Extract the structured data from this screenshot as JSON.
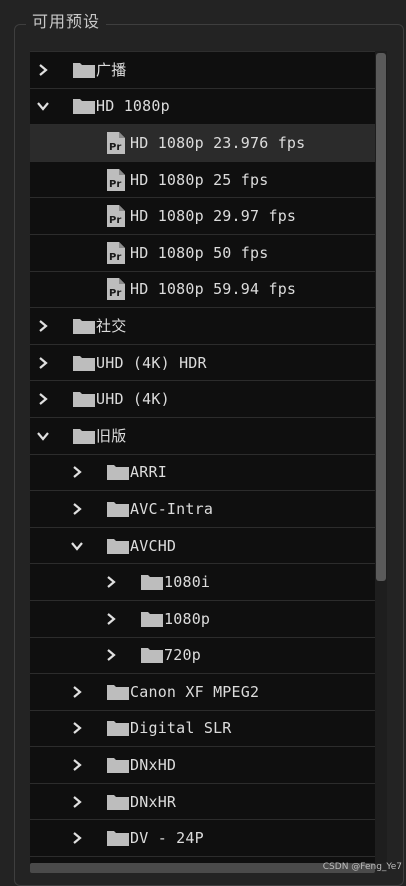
{
  "panel": {
    "title": "可用预设"
  },
  "tree": [
    {
      "depth": 0,
      "kind": "folder",
      "state": "collapsed",
      "label": "广播"
    },
    {
      "depth": 0,
      "kind": "folder",
      "state": "expanded",
      "label": "HD 1080p"
    },
    {
      "depth": 1,
      "kind": "preset",
      "label": "HD 1080p 23.976 fps",
      "selected": true
    },
    {
      "depth": 1,
      "kind": "preset",
      "label": "HD 1080p 25 fps"
    },
    {
      "depth": 1,
      "kind": "preset",
      "label": "HD 1080p 29.97 fps"
    },
    {
      "depth": 1,
      "kind": "preset",
      "label": "HD 1080p 50 fps"
    },
    {
      "depth": 1,
      "kind": "preset",
      "label": "HD 1080p 59.94 fps"
    },
    {
      "depth": 0,
      "kind": "folder",
      "state": "collapsed",
      "label": "社交"
    },
    {
      "depth": 0,
      "kind": "folder",
      "state": "collapsed",
      "label": "UHD (4K) HDR"
    },
    {
      "depth": 0,
      "kind": "folder",
      "state": "collapsed",
      "label": "UHD (4K)"
    },
    {
      "depth": 0,
      "kind": "folder",
      "state": "expanded",
      "label": "旧版"
    },
    {
      "depth": 1,
      "kind": "folder",
      "state": "collapsed",
      "label": "ARRI"
    },
    {
      "depth": 1,
      "kind": "folder",
      "state": "collapsed",
      "label": "AVC-Intra"
    },
    {
      "depth": 1,
      "kind": "folder",
      "state": "expanded",
      "label": "AVCHD"
    },
    {
      "depth": 2,
      "kind": "folder",
      "state": "collapsed",
      "label": "1080i"
    },
    {
      "depth": 2,
      "kind": "folder",
      "state": "collapsed",
      "label": "1080p"
    },
    {
      "depth": 2,
      "kind": "folder",
      "state": "collapsed",
      "label": "720p"
    },
    {
      "depth": 1,
      "kind": "folder",
      "state": "collapsed",
      "label": "Canon XF MPEG2"
    },
    {
      "depth": 1,
      "kind": "folder",
      "state": "collapsed",
      "label": "Digital SLR"
    },
    {
      "depth": 1,
      "kind": "folder",
      "state": "collapsed",
      "label": "DNxHD"
    },
    {
      "depth": 1,
      "kind": "folder",
      "state": "collapsed",
      "label": "DNxHR"
    },
    {
      "depth": 1,
      "kind": "folder",
      "state": "collapsed",
      "label": "DV - 24P"
    }
  ],
  "watermark": "CSDN @Feng_Ye7",
  "colors": {
    "background": "#0f0f0f",
    "selected_row": "#2b2b2b",
    "text": "#dcdcdc",
    "icon": "#bdbdbd"
  }
}
